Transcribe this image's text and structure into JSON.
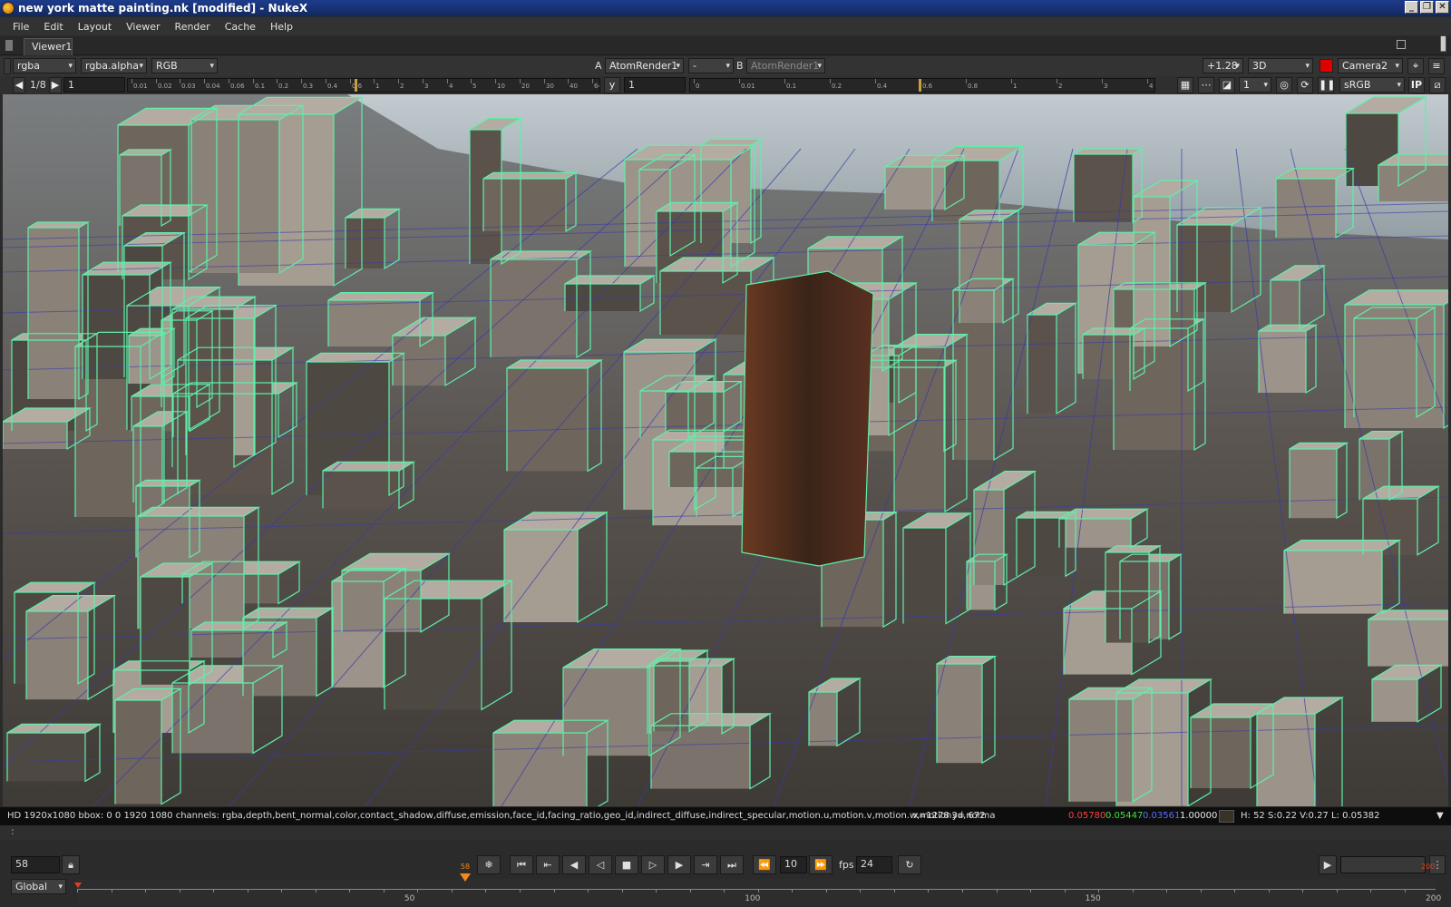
{
  "window": {
    "title": "new york matte painting.nk [modified] - NukeX",
    "minimize": "_",
    "restore": "❐",
    "close": "✕"
  },
  "menu": [
    "File",
    "Edit",
    "Layout",
    "Viewer",
    "Render",
    "Cache",
    "Help"
  ],
  "tab": {
    "label": "Viewer1"
  },
  "viewer_controls": {
    "channels": "rgba",
    "alpha_channel": "rgba.alpha",
    "display": "RGB",
    "input_a_label": "A",
    "input_a": "AtomRender1",
    "compare_mode": "-",
    "input_b_label": "B",
    "input_b": "AtomRender1",
    "gain": "+1.28",
    "view_mode": "3D",
    "camera": "Camera2",
    "proxy": "1/8",
    "frame_field": "1",
    "gamma_label": "y",
    "gamma_value": "1",
    "downrez": "1",
    "lut": "sRGB",
    "ip_label": "IP"
  },
  "gain_ruler_labels": [
    "0.01",
    "0.02",
    "0.03",
    "0.04",
    "0.06",
    "0.1",
    "0.2",
    "0.3",
    "0.4",
    "0.6",
    "1",
    "2",
    "3",
    "4",
    "5",
    "10",
    "20",
    "30",
    "40",
    "64"
  ],
  "gamma_ruler_labels": [
    "0",
    "0.01",
    "0.1",
    "0.2",
    "0.4",
    "0.6",
    "0.8",
    "1",
    "2",
    "3",
    "4"
  ],
  "info_bar": {
    "info": "HD 1920x1080 bbox: 0 0 1920 1080 channels: rgba,depth,bent_normal,color,contact_shadow,diffuse,emission,face_id,facing_ratio,geo_id,indirect_diffuse,indirect_specular,motion.u,motion.v,motion.w,motion3d,norma",
    "coords": "x=1278 y= 672",
    "r": "0.05780",
    "g": "0.05447",
    "b": "0.03561",
    "a": "1.00000",
    "hsvl": "H: 52 S:0.22 V:0.27  L: 0.05382",
    "swatch_color": "#3a3226"
  },
  "separator_text": ":",
  "playback": {
    "current_frame": "58",
    "step": "10",
    "fps_label": "fps",
    "fps": "24",
    "range_mode": "Global"
  },
  "timeline": {
    "start": 1,
    "end": 200,
    "current": 58,
    "labels": [
      "50",
      "100",
      "150",
      "200"
    ],
    "current_label": "58",
    "end_label": "200"
  },
  "colors": {
    "wireframe": "#5ef0a8",
    "grid": "#3a3aa8",
    "accent_orange": "#f08a1c",
    "red": "#e00000"
  }
}
